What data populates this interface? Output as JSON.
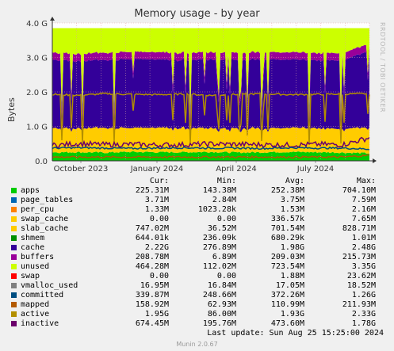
{
  "title": "Memory usage - by year",
  "watermark": "RRDTOOL / TOBI OETIKER",
  "footer": "Munin 2.0.67",
  "last_update": "Last update: Sun Aug 25 15:25:00 2024",
  "columns": [
    "Cur:",
    "Min:",
    "Avg:",
    "Max:"
  ],
  "legend": [
    {
      "name": "apps",
      "color": "#00cc00",
      "cur": "225.31M",
      "min": "143.38M",
      "avg": "252.38M",
      "max": "704.10M"
    },
    {
      "name": "page_tables",
      "color": "#0066b3",
      "cur": "3.71M",
      "min": "2.84M",
      "avg": "3.75M",
      "max": "7.59M"
    },
    {
      "name": "per_cpu",
      "color": "#ff8000",
      "cur": "1.33M",
      "min": "1023.28k",
      "avg": "1.53M",
      "max": "2.16M"
    },
    {
      "name": "swap_cache",
      "color": "#ffcc00",
      "cur": "0.00",
      "min": "0.00",
      "avg": "336.57k",
      "max": "7.65M"
    },
    {
      "name": "slab_cache",
      "color": "#ffcc00",
      "cur": "747.02M",
      "min": "36.52M",
      "avg": "701.54M",
      "max": "828.71M"
    },
    {
      "name": "shmem",
      "color": "#008f00",
      "cur": "644.01k",
      "min": "236.09k",
      "avg": "680.29k",
      "max": "1.01M"
    },
    {
      "name": "cache",
      "color": "#330099",
      "cur": "2.22G",
      "min": "276.89M",
      "avg": "1.98G",
      "max": "2.48G"
    },
    {
      "name": "buffers",
      "color": "#990099",
      "cur": "208.78M",
      "min": "6.89M",
      "avg": "209.03M",
      "max": "215.73M"
    },
    {
      "name": "unused",
      "color": "#ccff00",
      "cur": "464.28M",
      "min": "112.02M",
      "avg": "723.54M",
      "max": "3.35G"
    },
    {
      "name": "swap",
      "color": "#ff0000",
      "cur": "0.00",
      "min": "0.00",
      "avg": "1.88M",
      "max": "23.62M"
    },
    {
      "name": "vmalloc_used",
      "color": "#808080",
      "cur": "16.95M",
      "min": "16.84M",
      "avg": "17.05M",
      "max": "18.52M"
    },
    {
      "name": "committed",
      "color": "#004d80",
      "cur": "339.87M",
      "min": "248.66M",
      "avg": "372.26M",
      "max": "1.26G"
    },
    {
      "name": "mapped",
      "color": "#b35a00",
      "cur": "158.92M",
      "min": "62.93M",
      "avg": "110.99M",
      "max": "211.93M"
    },
    {
      "name": "active",
      "color": "#b38f00",
      "cur": "1.95G",
      "min": "86.00M",
      "avg": "1.93G",
      "max": "2.33G"
    },
    {
      "name": "inactive",
      "color": "#6b006b",
      "cur": "674.45M",
      "min": "195.76M",
      "avg": "473.60M",
      "max": "1.78G"
    }
  ],
  "chart_data": {
    "type": "area",
    "title": "Memory usage - by year",
    "ylabel": "Bytes",
    "ylim": [
      0,
      4
    ],
    "yunit": "G",
    "yticks": [
      "0.0",
      "1.0 G",
      "2.0 G",
      "3.0 G",
      "4.0 G"
    ],
    "xticks": [
      "October 2023",
      "January 2024",
      "April 2024",
      "July 2024"
    ],
    "grid": true,
    "x": [
      "2023-08",
      "2023-09",
      "2023-10",
      "2023-11",
      "2023-12",
      "2024-01",
      "2024-02",
      "2024-03",
      "2024-04",
      "2024-05",
      "2024-06",
      "2024-07",
      "2024-08"
    ],
    "series": [
      {
        "name": "apps",
        "values": [
          0.25,
          0.25,
          0.24,
          0.26,
          0.25,
          0.25,
          0.26,
          0.24,
          0.25,
          0.26,
          0.25,
          0.24,
          0.22
        ]
      },
      {
        "name": "slab_cache",
        "values": [
          0.7,
          0.7,
          0.72,
          0.7,
          0.71,
          0.7,
          0.7,
          0.7,
          0.7,
          0.7,
          0.7,
          0.7,
          0.75
        ]
      },
      {
        "name": "cache",
        "values": [
          1.98,
          1.95,
          1.97,
          2.0,
          1.98,
          1.97,
          1.99,
          1.98,
          2.0,
          1.98,
          1.97,
          1.99,
          2.22
        ]
      },
      {
        "name": "buffers",
        "values": [
          0.21,
          0.21,
          0.21,
          0.21,
          0.21,
          0.21,
          0.21,
          0.21,
          0.21,
          0.21,
          0.21,
          0.21,
          0.21
        ]
      },
      {
        "name": "unused",
        "values": [
          0.72,
          0.75,
          0.72,
          0.69,
          0.71,
          0.73,
          0.7,
          0.73,
          0.7,
          0.71,
          0.73,
          0.72,
          0.46
        ]
      },
      {
        "name": "active",
        "values": [
          1.93,
          1.9,
          1.95,
          1.93,
          1.92,
          1.94,
          1.9,
          1.93,
          1.95,
          1.92,
          1.93,
          1.94,
          1.95
        ]
      },
      {
        "name": "inactive",
        "values": [
          0.45,
          0.5,
          0.47,
          0.48,
          0.46,
          0.47,
          0.49,
          0.48,
          0.47,
          0.46,
          0.48,
          0.47,
          0.67
        ]
      },
      {
        "name": "committed",
        "values": [
          0.37,
          0.38,
          0.37,
          0.36,
          0.37,
          0.38,
          0.37,
          0.37,
          0.36,
          0.38,
          0.37,
          0.37,
          0.34
        ]
      },
      {
        "name": "mapped",
        "values": [
          0.11,
          0.11,
          0.11,
          0.11,
          0.11,
          0.11,
          0.11,
          0.11,
          0.11,
          0.11,
          0.11,
          0.11,
          0.16
        ]
      }
    ]
  }
}
